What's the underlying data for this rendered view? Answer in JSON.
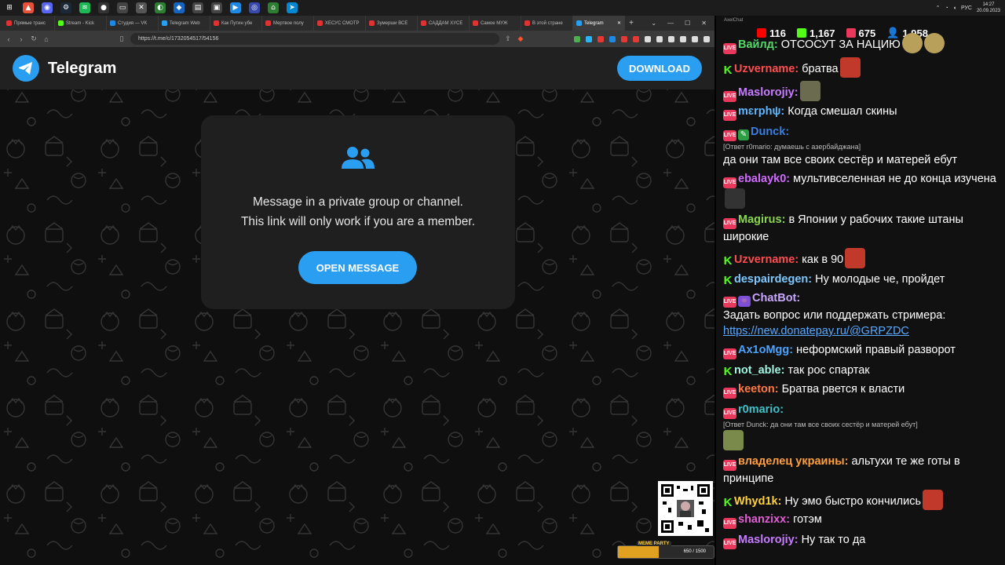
{
  "taskbar": {
    "tray": {
      "lang": "РУС",
      "time": "14:27",
      "date": "20.09.2023"
    }
  },
  "browser": {
    "tabs": [
      {
        "label": "Прямые транс"
      },
      {
        "label": "Stream - Kick"
      },
      {
        "label": "Студия — VK"
      },
      {
        "label": "Telegram Web"
      },
      {
        "label": "Как Путин убе"
      },
      {
        "label": "Мертвое полу"
      },
      {
        "label": "ХЕСУС СМОТР"
      },
      {
        "label": "Зумерши ВСЕ"
      },
      {
        "label": "САДДАМ ХУСЕ"
      },
      {
        "label": "Самое МУЖ"
      },
      {
        "label": "В этой стране"
      },
      {
        "label": "Telegram"
      }
    ],
    "url": "https://t.me/c/1732054517/54156"
  },
  "telegram": {
    "title": "Telegram",
    "download_label": "DOWNLOAD",
    "message_line1": "Message in a private group or channel.",
    "message_line2": "This link will only work if you are a member.",
    "open_label": "OPEN MESSAGE",
    "accent": "#2a9ef1"
  },
  "overlay": {
    "meme_label": "MEME PARTY",
    "meme_count": "650 / 1500",
    "meme_progress": 0.43
  },
  "chat": {
    "app_name": "AxelChat",
    "stats": {
      "youtube": "116",
      "kick": "1,167",
      "vk": "675",
      "viewers": "1,958"
    },
    "messages": [
      {
        "badge": "live",
        "user": "Вайлд:",
        "color": "#53d86a",
        "text": "ОТСОСУТ ЗА НАЦИЮ"
      },
      {
        "badge": "kick",
        "user": "Uzvername:",
        "color": "#ff4d4d",
        "text": "братва"
      },
      {
        "badge": "live",
        "user": "Maslorojiy:",
        "color": "#c77dff",
        "text": ""
      },
      {
        "badge": "live",
        "user": "mɛrphψ:",
        "color": "#5fb8ff",
        "text": "Когда смешал скины"
      },
      {
        "badge": "live",
        "user": "Dunck:",
        "color": "#3a7fe0",
        "text": "",
        "reply": "[Ответ r0mario: думаешь с азербайджана]",
        "cont": "да они там все своих сестёр и матерей ебут"
      },
      {
        "badge": "live",
        "user": "ebalayk0:",
        "color": "#d16bff",
        "text": "мультивселенная не до конца изучена"
      },
      {
        "badge": "live",
        "user": "Magirus:",
        "color": "#8ad64f",
        "text": "в Японии у рабочих такие штаны широкие"
      },
      {
        "badge": "kick",
        "user": "Uzvername:",
        "color": "#ff4d4d",
        "text": "как в 90"
      },
      {
        "badge": "kick",
        "user": "despairdegen:",
        "color": "#7ec8ff",
        "text": "Ну молодые че, пройдет"
      },
      {
        "badge": "live",
        "user": "ChatBot:",
        "color": "#c9a6ff",
        "text": "",
        "cont": "Задать вопрос или поддержать стримера:",
        "link": "https://new.donatepay.ru/@GRPZDC"
      },
      {
        "badge": "live",
        "user": "Ax1oMgg:",
        "color": "#4aa3ff",
        "text": "неформский правый разворот"
      },
      {
        "badge": "kick",
        "user": "not_able:",
        "color": "#9ff5e0",
        "text": "так рос спартак"
      },
      {
        "badge": "live",
        "user": "keeton:",
        "color": "#ff7a45",
        "text": "Братва рвется к власти"
      },
      {
        "badge": "live",
        "user": "r0mario:",
        "color": "#3fc1c9",
        "text": "",
        "reply": "[Ответ Dunck: да они там все своих сестёр и матерей ебут]"
      },
      {
        "badge": "live",
        "user": "владелец украины:",
        "color": "#ff9f40",
        "text": "альтухи те же готы в принципе"
      },
      {
        "badge": "kick",
        "user": "Whyd1k:",
        "color": "#ffd23f",
        "text": "Ну эмо быстро кончились"
      },
      {
        "badge": "live",
        "user": "shanzixx:",
        "color": "#e05fd4",
        "text": "готэм"
      },
      {
        "badge": "live",
        "user": "Maslorojiy:",
        "color": "#c77dff",
        "text": "Ну так то да"
      }
    ]
  }
}
